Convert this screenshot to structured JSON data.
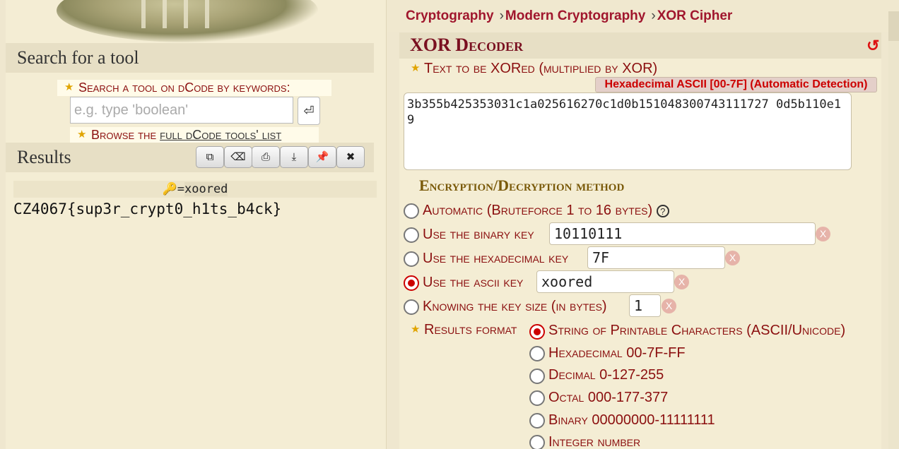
{
  "search": {
    "heading": "Search for a tool",
    "label": "Search a tool on dCode by keywords:",
    "placeholder": "e.g. type 'boolean'",
    "go_icon": "enter-icon",
    "browse_prefix": "Browse the ",
    "browse_link": "full dCode tools' list"
  },
  "results": {
    "heading": "Results",
    "toolbar": [
      "copy-icon",
      "clear-icon",
      "print-icon",
      "download-icon",
      "pin-icon",
      "close-icon"
    ],
    "key_label": "=",
    "key_value": "xoored",
    "output": "CZ4067{sup3r_crypt0_h1ts_b4ck}"
  },
  "breadcrumb": [
    "Cryptography",
    "Modern Cryptography",
    "XOR Cipher"
  ],
  "decoder": {
    "title": "XOR Decoder",
    "text_label": "Text to be XORed (multiplied by XOR)",
    "detection": "Hexadecimal ASCII [00-7F] (Automatic Detection)",
    "ciphertext": "3b355b425353031c1a025616270c1d0b151048300743111727 0d5b110e19",
    "method_label": "Encryption/Decryption method",
    "methods": [
      {
        "label": "Automatic (Bruteforce 1 to 16 bytes)",
        "selected": false
      },
      {
        "label": "Use the binary key",
        "value": "10110111",
        "selected": false
      },
      {
        "label": "Use the hexadecimal key",
        "value": "7F",
        "selected": false
      },
      {
        "label": "Use the ascii key",
        "value": "xoored",
        "selected": true
      },
      {
        "label": "Knowing the key size (in bytes)",
        "value": "1",
        "selected": false
      }
    ],
    "results_format_label": "Results format",
    "formats": [
      {
        "label": "String of Printable Characters (ASCII/Unicode)",
        "selected": true
      },
      {
        "label": "Hexadecimal 00-7F-FF",
        "selected": false
      },
      {
        "label": "Decimal 0-127-255",
        "selected": false
      },
      {
        "label": "Octal 000-177-377",
        "selected": false
      },
      {
        "label": "Binary 00000000-11111111",
        "selected": false
      },
      {
        "label": "Integer number",
        "selected": false
      }
    ]
  },
  "colors": {
    "accent": "#8b0f0f",
    "link": "#a0162d",
    "panel": "#f4edd4"
  }
}
